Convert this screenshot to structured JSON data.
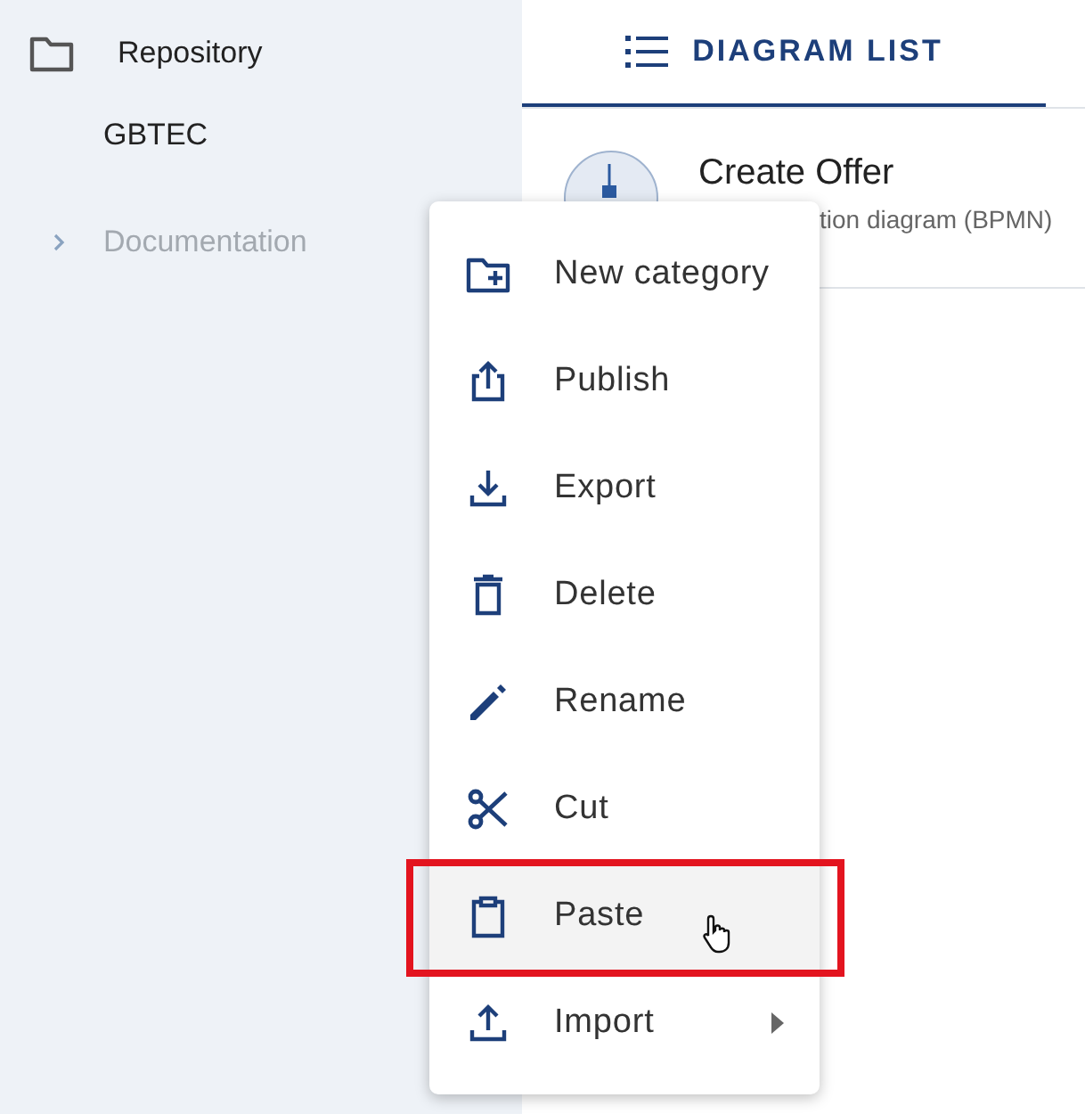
{
  "sidebar": {
    "tree": [
      {
        "label": "Repository",
        "children": [
          {
            "label": "GBTEC",
            "disabled": false
          },
          {
            "label": "Documentation",
            "disabled": true,
            "expanded": false
          }
        ]
      }
    ]
  },
  "tabs": [
    {
      "label": "DIAGRAM LIST",
      "selected": true
    }
  ],
  "diagrams": [
    {
      "title": "Create Offer",
      "subtitle": "tion diagram (BPMN)"
    }
  ],
  "context_menu": {
    "items": [
      {
        "label": "New category",
        "selected": false,
        "submenu": false
      },
      {
        "label": "Publish",
        "selected": false,
        "submenu": false
      },
      {
        "label": "Export",
        "selected": false,
        "submenu": false
      },
      {
        "label": "Delete",
        "selected": false,
        "submenu": false
      },
      {
        "label": "Rename",
        "selected": false,
        "submenu": false
      },
      {
        "label": "Cut",
        "selected": false,
        "submenu": false
      },
      {
        "label": "Paste",
        "selected": true,
        "submenu": false
      },
      {
        "label": "Import",
        "selected": false,
        "submenu": true
      }
    ]
  }
}
